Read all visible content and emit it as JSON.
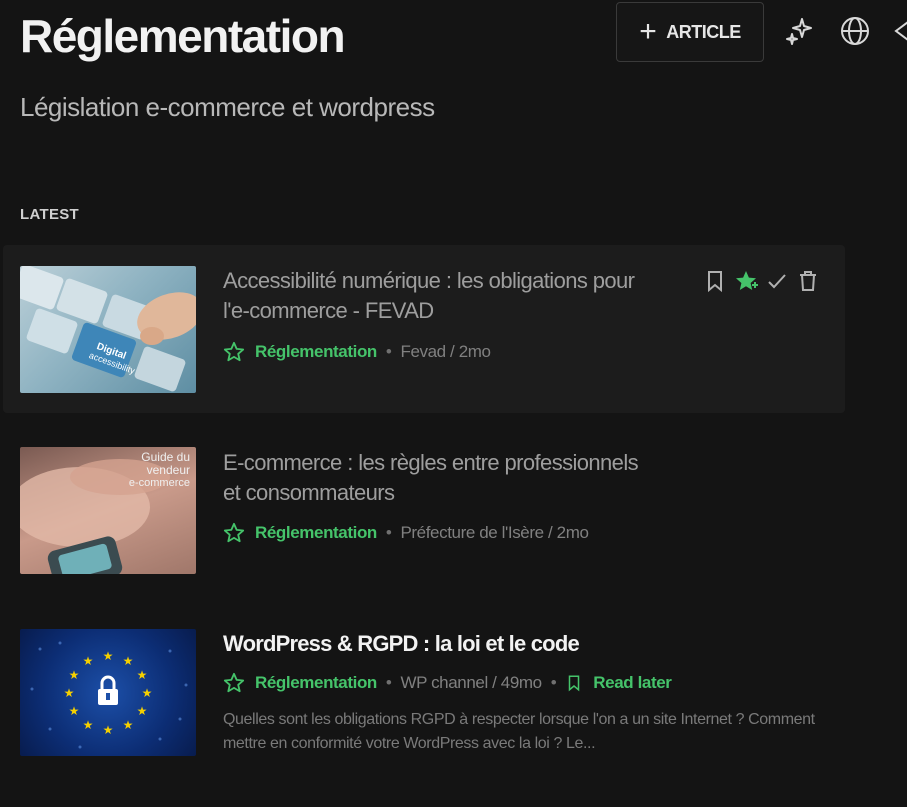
{
  "header": {
    "title": "Réglementation",
    "subtitle": "Législation e-commerce et wordpress",
    "add_article_label": "ARTICLE",
    "icons": [
      "sparkles-icon",
      "globe-icon",
      "share-icon"
    ]
  },
  "section": {
    "label": "LATEST"
  },
  "articles": [
    {
      "title": "Accessibilité numérique : les obligations pour l'e-commerce - FEVAD",
      "category": "Réglementation",
      "source": "Fevad / 2mo",
      "thumbnail_text": [
        "Digital",
        "accessibility"
      ],
      "highlighted": true,
      "actions": [
        "bookmark-icon",
        "star-filled-icon",
        "check-icon",
        "trash-icon"
      ],
      "colors": {
        "accent": "#45c36a"
      }
    },
    {
      "title": "E-commerce : les règles entre professionnels et consommateurs",
      "category": "Réglementation",
      "source": "Préfecture de l'Isère / 2mo",
      "thumbnail_text": [
        "Guide du",
        "vendeur",
        "e-commerce"
      ]
    },
    {
      "title": "WordPress & RGPD : la loi et le code",
      "category": "Réglementation",
      "source": "WP channel / 49mo",
      "read_later": "Read later",
      "excerpt": "Quelles sont les obligations RGPD à respecter lorsque l'on a un site Internet ? Comment mettre en conformité votre WordPress avec la loi ? Le..."
    }
  ]
}
